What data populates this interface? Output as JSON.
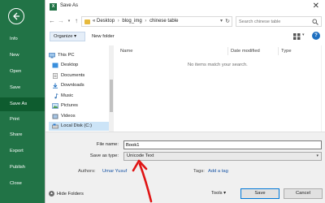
{
  "backstage": {
    "menu": [
      "Info",
      "New",
      "Open",
      "Save",
      "Save As",
      "Print",
      "Share",
      "Export",
      "Publish",
      "Close"
    ],
    "active": "Save As",
    "accent_color": "#217346"
  },
  "dialog": {
    "title": "Save As",
    "close_glyph": "✕",
    "breadcrumb": [
      "«",
      "Desktop",
      "blog_img",
      "chinese table"
    ],
    "search_placeholder": "Search chinese table",
    "organize_label": "Organize ▾",
    "new_folder_label": "New folder",
    "help_glyph": "?",
    "tree": [
      "This PC",
      "Desktop",
      "Documents",
      "Downloads",
      "Music",
      "Pictures",
      "Videos",
      "Local Disk (C:)"
    ],
    "columns": [
      "Name",
      "Date modified",
      "Type"
    ],
    "empty_message": "No items match your search.",
    "file_name_label": "File name:",
    "file_name_value": "Book1",
    "save_type_label": "Save as type:",
    "save_type_value": "Unicode Text",
    "authors_label": "Authors:",
    "authors_value": "Umar Yusuf",
    "tags_label": "Tags:",
    "tags_value": "Add a tag",
    "hide_folders_label": "Hide Folders",
    "tools_label": "Tools ▾",
    "save_label": "Save",
    "cancel_label": "Cancel"
  }
}
